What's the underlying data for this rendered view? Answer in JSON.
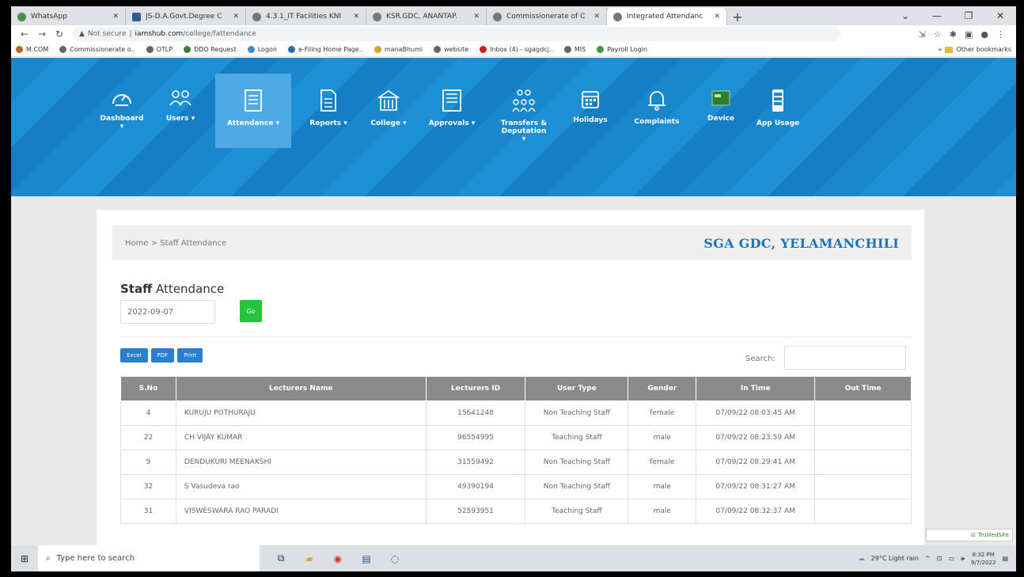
{
  "browser": {
    "tabs": [
      {
        "title": "WhatsApp",
        "active": false
      },
      {
        "title": "JS-D.A.Govt.Degree C",
        "active": false
      },
      {
        "title": "4.3.1_IT Facilities KNI",
        "active": false
      },
      {
        "title": "KSR.GDC, ANANTAP.",
        "active": false
      },
      {
        "title": "Commissionerate of C",
        "active": false
      },
      {
        "title": "Integrated Attendanc",
        "active": true
      }
    ],
    "address": {
      "security": "Not secure",
      "host": "iamshub.com",
      "path": "/college/fattendance"
    },
    "bookmarks": [
      "M.COM",
      "Commissionerate o..",
      "OTLP",
      "DDO Request",
      "Logon",
      "e-Filing Home Page..",
      "manaBhumi",
      "website",
      "Inbox (4) - sgagdcj..",
      "MIS",
      "Payroll Login"
    ],
    "other_bookmarks": "Other bookmarks"
  },
  "nav": {
    "items": [
      {
        "label": "Dashboard",
        "arrow": "▾",
        "icon": "dashboard-icon"
      },
      {
        "label": "Users",
        "arrow": "▾",
        "icon": "users-icon"
      },
      {
        "label": "Attendance",
        "arrow": "▾",
        "icon": "attendance-icon"
      },
      {
        "label": "Reports",
        "arrow": "▾",
        "icon": "reports-icon"
      },
      {
        "label": "College",
        "arrow": "▾",
        "icon": "college-icon"
      },
      {
        "label": "Approvals",
        "arrow": "▾",
        "icon": "approvals-icon"
      },
      {
        "label": "Transfers & Deputation",
        "arrow": "▾",
        "icon": "transfers-icon"
      },
      {
        "label": "Holidays",
        "arrow": "",
        "icon": "holidays-icon"
      },
      {
        "label": "Complaints",
        "arrow": "",
        "icon": "complaints-icon"
      },
      {
        "label": "Device",
        "arrow": "",
        "icon": "device-icon"
      },
      {
        "label": "App Usage",
        "arrow": "",
        "icon": "app-usage-icon"
      }
    ],
    "active_index": 2
  },
  "breadcrumb": {
    "home": "Home",
    "sep": ">",
    "current": "Staff Attendance"
  },
  "college_name": "SGA GDC, YELAMANCHILI",
  "page_title": {
    "bold": "Staff",
    "rest": "Attendance"
  },
  "date_value": "2022-09-07",
  "go_label": "Go",
  "export_buttons": [
    "Excel",
    "PDF",
    "Print"
  ],
  "search_label": "Search:",
  "table": {
    "headers": [
      "S.No",
      "Lecturers Name",
      "Lecturers ID",
      "User Type",
      "Gender",
      "In Time",
      "Out Time"
    ],
    "rows": [
      [
        "4",
        "KURUJU POTHURAJU",
        "15641248",
        "Non Teaching Staff",
        "female",
        "07/09/22 08:03:45 AM",
        ""
      ],
      [
        "22",
        "CH VIJAY KUMAR",
        "96554995",
        "Teaching Staff",
        "male",
        "07/09/22 08:23:59 AM",
        ""
      ],
      [
        "9",
        "DENDUKURI MEENAKSHI",
        "31559492",
        "Non Teaching Staff",
        "female",
        "07/09/22 08:29:41 AM",
        ""
      ],
      [
        "32",
        "S Vasudeva rao",
        "49390194",
        "Non Teaching Staff",
        "male",
        "07/09/22 08:31:27 AM",
        ""
      ],
      [
        "31",
        "VISWESWARA RAO PARADI",
        "52593951",
        "Teaching Staff",
        "male",
        "07/09/22 08:32:37 AM",
        ""
      ]
    ]
  },
  "trusted_badge": "TrustedSite",
  "taskbar": {
    "search_placeholder": "Type here to search",
    "weather": "29°C  Light rain",
    "time": "8:32 PM",
    "date": "9/7/2022"
  }
}
